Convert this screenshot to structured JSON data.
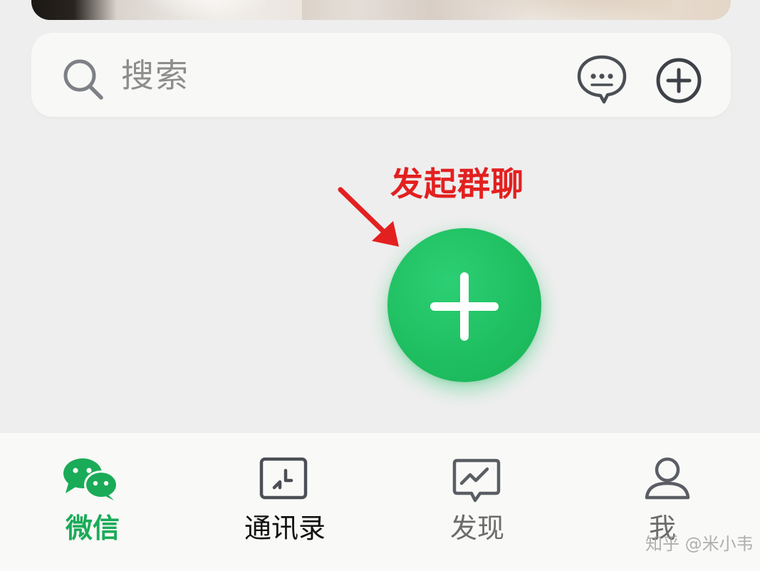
{
  "search": {
    "placeholder": "搜索"
  },
  "annotation": {
    "label": "发起群聊"
  },
  "tabs": {
    "weixin": "微信",
    "contacts": "通讯录",
    "discover": "发现",
    "me": "我"
  },
  "watermark": "知乎 @米小韦",
  "colors": {
    "accent_green": "#1aab58",
    "fab_green": "#1ebe60",
    "annotation_red": "#e32020"
  },
  "icons": {
    "search": "search-icon",
    "message": "message-icon",
    "add": "add-circle-icon",
    "fab": "plus-icon",
    "weixin": "chat-bubbles-icon",
    "contacts": "contacts-icon",
    "discover": "discover-icon",
    "me": "person-icon"
  }
}
